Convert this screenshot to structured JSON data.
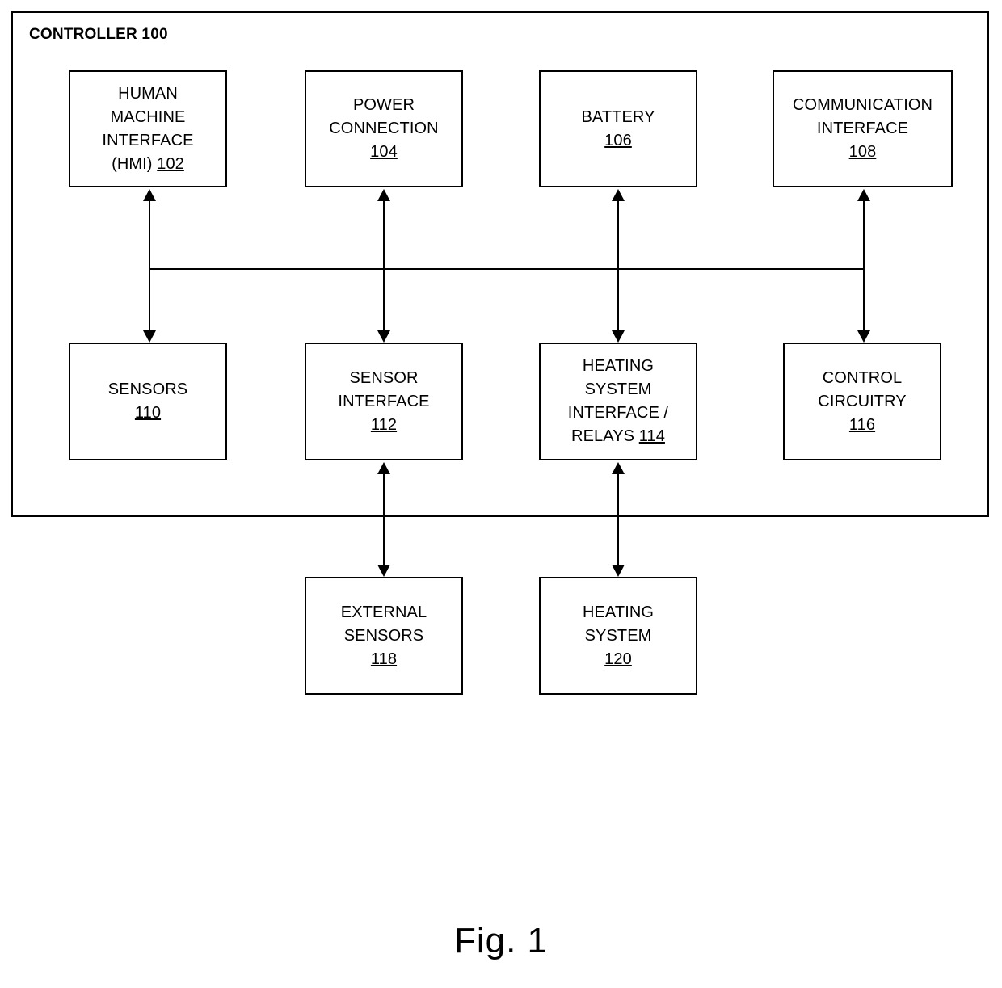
{
  "figure": {
    "caption": "Fig. 1",
    "controller": {
      "title_text": "CONTROLLER ",
      "title_ref": "100"
    }
  },
  "blocks": {
    "hmi": {
      "label": "HUMAN\nMACHINE\nINTERFACE\n(HMI) ",
      "ref": "102"
    },
    "power_connection": {
      "label": "POWER\nCONNECTION\n",
      "ref": "104"
    },
    "battery": {
      "label": "BATTERY\n",
      "ref": "106"
    },
    "communication_interface": {
      "label": "COMMUNICATION\nINTERFACE\n",
      "ref": "108"
    },
    "sensors": {
      "label": "SENSORS\n",
      "ref": "110"
    },
    "sensor_interface": {
      "label": "SENSOR\nINTERFACE\n",
      "ref": "112"
    },
    "heating_system_interface": {
      "label": "HEATING\nSYSTEM\nINTERFACE /\nRELAYS ",
      "ref": "114"
    },
    "control_circuitry": {
      "label": "CONTROL\nCIRCUITRY\n",
      "ref": "116"
    },
    "external_sensors": {
      "label": "EXTERNAL\nSENSORS\n",
      "ref": "118"
    },
    "heating_system": {
      "label": "HEATING\nSYSTEM\n",
      "ref": "120"
    }
  },
  "colors": {
    "stroke": "#000000",
    "background": "#ffffff"
  }
}
